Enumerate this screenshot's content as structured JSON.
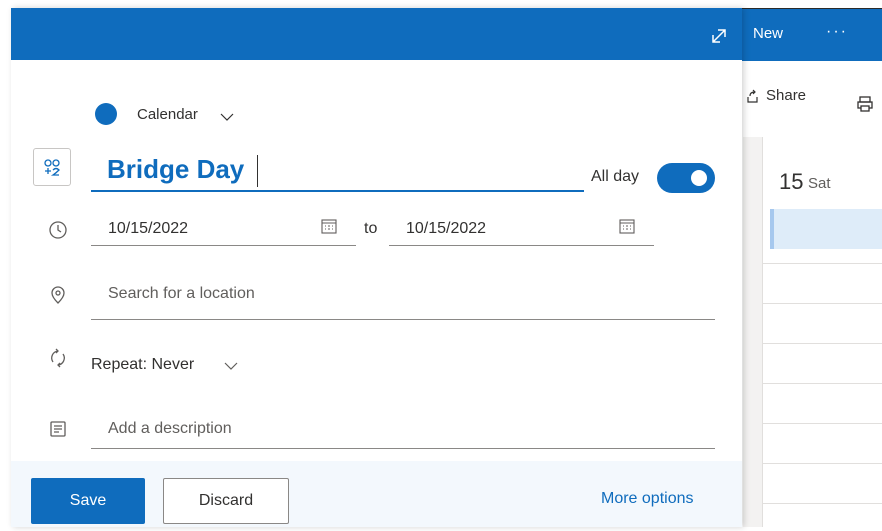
{
  "header": {
    "new_label": "New",
    "more_label": "···",
    "expand_icon": "expand-icon"
  },
  "toolbar": {
    "share_label": "Share",
    "share_icon": "share-icon",
    "print_icon": "print-icon"
  },
  "calendar_view": {
    "day_number": "15",
    "day_name": "Sat"
  },
  "event": {
    "calendar_name": "Calendar",
    "calendar_color": "#0f6cbd",
    "title_value": "Bridge Day",
    "all_day_label": "All day",
    "all_day_on": true,
    "start_date": "10/15/2022",
    "to_label": "to",
    "end_date": "10/15/2022",
    "location_placeholder": "Search for a location",
    "repeat_label": "Repeat: Never",
    "description_placeholder": "Add a description"
  },
  "footer": {
    "save_label": "Save",
    "discard_label": "Discard",
    "more_options_label": "More options"
  },
  "colors": {
    "accent": "#0f6cbd",
    "footer_bg": "#f3f8fd"
  }
}
